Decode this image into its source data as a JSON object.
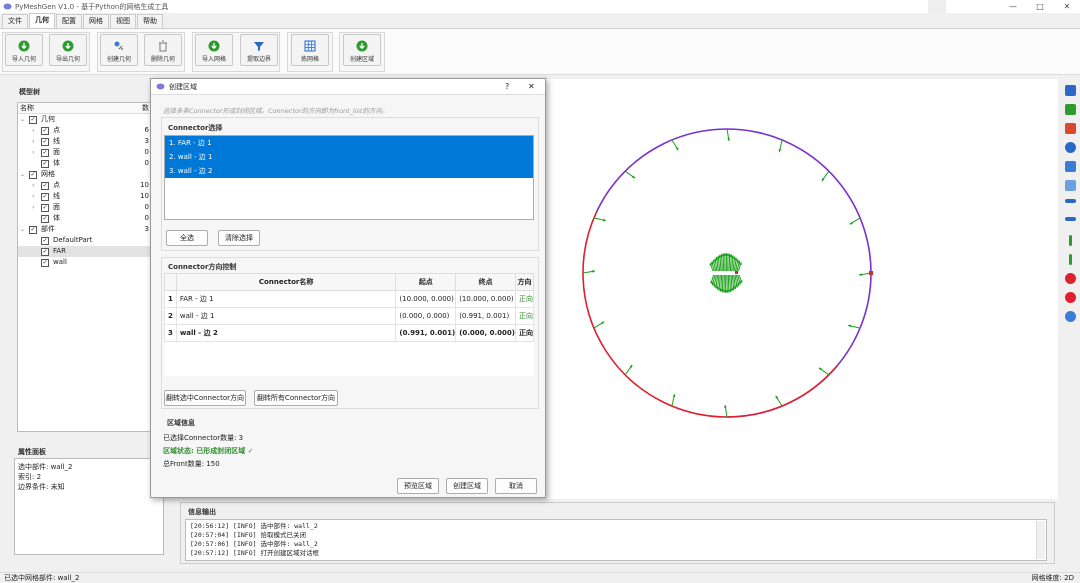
{
  "app": {
    "title": "PyMeshGen V1.0 - 基于Python的网格生成工具",
    "window_controls": [
      "—",
      "□",
      "✕"
    ]
  },
  "menu_tabs": [
    "文件",
    "几何",
    "配置",
    "网格",
    "视图",
    "帮助"
  ],
  "toolbar": {
    "import_geo": "导入几何",
    "export_geo": "导出几何",
    "create_geo": "创建几何",
    "delete_geo": "删除几何",
    "import_mesh": "导入网格",
    "extract_boundary": "提取边界",
    "select_mesh": "拣网格",
    "create_region": "创建区域"
  },
  "model_tree": {
    "title": "模型树",
    "col_name": "名称",
    "col_count": "数",
    "rows": [
      {
        "label": "几何",
        "count": ""
      },
      {
        "label": "点",
        "count": "6"
      },
      {
        "label": "线",
        "count": "3"
      },
      {
        "label": "面",
        "count": "0"
      },
      {
        "label": "体",
        "count": "0"
      },
      {
        "label": "网格",
        "count": ""
      },
      {
        "label": "点",
        "count": "10"
      },
      {
        "label": "线",
        "count": "10"
      },
      {
        "label": "面",
        "count": "0"
      },
      {
        "label": "体",
        "count": "0"
      },
      {
        "label": "部件",
        "count": "3"
      },
      {
        "label": "DefaultPart",
        "count": ""
      },
      {
        "label": "FAR",
        "count": ""
      },
      {
        "label": "wall",
        "count": ""
      }
    ]
  },
  "properties": {
    "title": "属性面板",
    "lines": [
      "选中部件: wall_2",
      "索引: 2",
      "边界条件: 未知"
    ]
  },
  "dialog": {
    "title": "创建区域",
    "help": "?",
    "close": "✕",
    "description": "选择多条Connector形成封闭区域。Connector的方向即为front_list的方向。",
    "connector_select": {
      "title": "Connector选择",
      "items": [
        "1. FAR - 边 1",
        "2. wall - 边 1",
        "3. wall - 边 2"
      ],
      "select_all": "全选",
      "clear": "清除选择"
    },
    "direction": {
      "title": "Connector方向控制",
      "headers": [
        "",
        "Connector名称",
        "起点",
        "终点",
        "方向"
      ],
      "rows": [
        {
          "idx": "1",
          "name": "FAR - 边 1",
          "start": "(10.000, 0.000)",
          "end": "(10.000, 0.000)",
          "dir": "正向"
        },
        {
          "idx": "2",
          "name": "wall - 边 1",
          "start": "(0.000, 0.000)",
          "end": "(0.991, 0.001)",
          "dir": "正向"
        },
        {
          "idx": "3",
          "name": "wall - 边 2",
          "start": "(0.991, 0.001)",
          "end": "(0.000, 0.000)",
          "dir": "正向"
        }
      ],
      "flip_selected": "翻转选中Connector方向",
      "flip_all": "翻转所有Connector方向"
    },
    "region_info": {
      "title": "区域信息",
      "selected_count": "已选择Connector数量: 3",
      "status": "区域状态: 已形成封闭区域 ✓",
      "front_count": "总Front数量: 150"
    },
    "buttons": {
      "preview": "预览区域",
      "create": "创建区域",
      "cancel": "取消"
    }
  },
  "message": {
    "title": "信息输出",
    "lines": [
      "[20:56:12] [INFO] 选中部件: wall_2",
      "[20:57:04] [INFO] 拾取模式已关闭",
      "[20:57:06] [INFO] 选中部件: wall_2",
      "[20:57:12] [INFO] 打开创建区域对话框"
    ]
  },
  "status": {
    "left": "已选中网格部件: wall_2",
    "right": "网格维度: 2D"
  },
  "colors": {
    "accent": "#0078d7",
    "circle_red": "#e0202f",
    "circle_purple": "#7a2fd0",
    "arrow_green": "#1aa01a",
    "dir_green": "#2e8b2e"
  }
}
